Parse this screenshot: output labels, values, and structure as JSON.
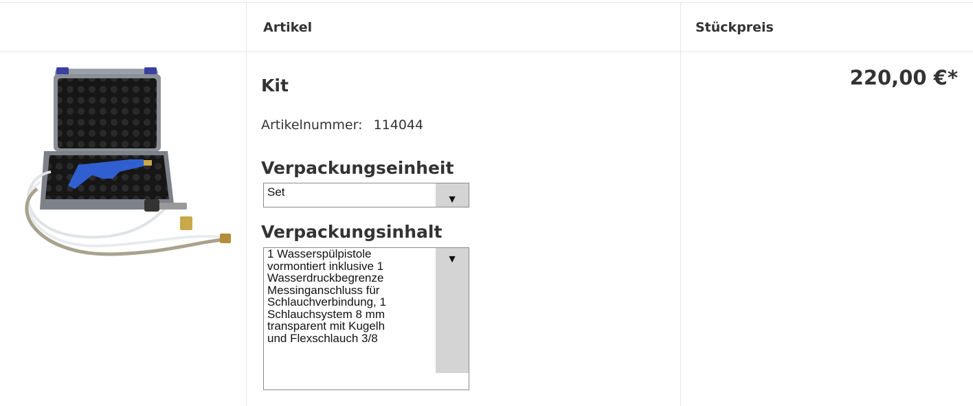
{
  "table": {
    "header": {
      "article": "Artikel",
      "unit_price": "Stückpreis"
    }
  },
  "product": {
    "name": "Kit",
    "article_number_label": "Artikelnummer:",
    "article_number": "114044",
    "packaging_unit": {
      "title": "Verpackungseinheit",
      "selected": "Set"
    },
    "packaging_contents": {
      "title": "Verpackungsinhalt",
      "lines": "1 Wasserspülpistole\nvormontiert inklusive 1\nWasserdruckbegrenze\nMessinganschluss für\nSchlauchverbindung, 1\nSchlauchsystem 8 mm\ntransparent mit Kugelh\nund Flexschlauch 3/8"
    },
    "price": "220,00 €*",
    "image_alt": "Kit with water spray gun in case, hose and braided flex hose"
  },
  "icons": {
    "dropdown": "▼"
  },
  "colors": {
    "border": "#e6e6e6",
    "select_border": "#8a8a8a",
    "arrow_bg": "#d4d4d4",
    "gun_blue": "#2f5fd0"
  }
}
